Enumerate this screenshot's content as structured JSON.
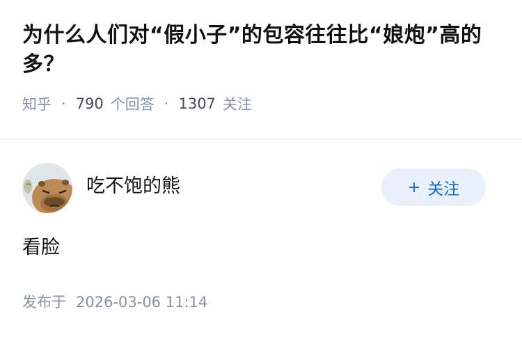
{
  "question": {
    "title": "为什么人们对“假小子”的包容往往比“娘炮”高的多？",
    "source": "知乎",
    "answer_count": "790",
    "answer_label": "个回答",
    "follower_count": "1307",
    "follower_label": "关注",
    "separator": "·"
  },
  "answer": {
    "author": {
      "name": "吃不饱的熊",
      "avatar_icon": "capybara-avatar-icon"
    },
    "follow_button": {
      "icon": "plus-icon",
      "label": "关注"
    },
    "content": "看脸",
    "published_label": "发布于",
    "published_time": "2026-03-06 11:14"
  },
  "colors": {
    "title": "#121212",
    "meta": "#8590a6",
    "follow_button_bg": "#ebf1fa",
    "follow_button_text": "#0d67d6"
  }
}
